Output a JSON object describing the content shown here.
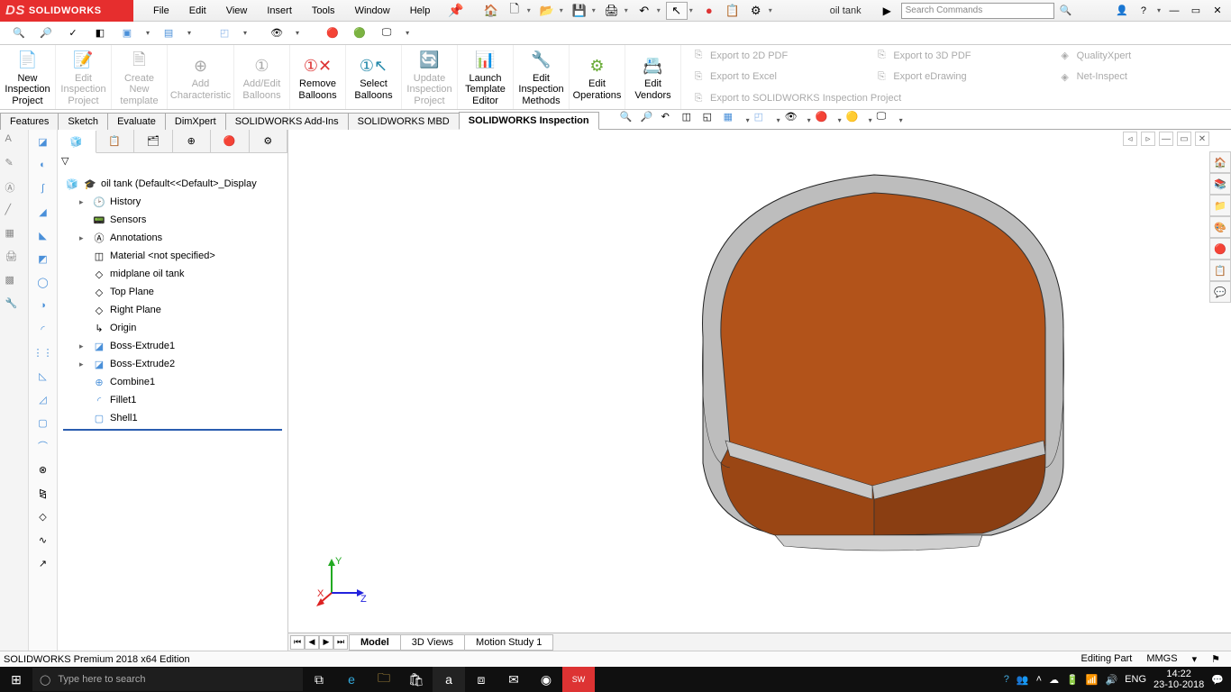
{
  "app_name": "SOLIDWORKS",
  "menus": [
    "File",
    "Edit",
    "View",
    "Insert",
    "Tools",
    "Window",
    "Help"
  ],
  "doc_title": "oil tank",
  "search_placeholder": "Search Commands",
  "ribbon": {
    "new_inspection": "New Inspection Project",
    "edit_inspection": "Edit Inspection Project",
    "create_template": "Create New template",
    "add_char": "Add Characteristic",
    "addedit_balloons": "Add/Edit Balloons",
    "remove_balloons": "Remove Balloons",
    "select_balloons": "Select Balloons",
    "update_project": "Update Inspection Project",
    "launch_te": "Launch Template Editor",
    "edit_methods": "Edit Inspection Methods",
    "edit_ops": "Edit Operations",
    "edit_vendors": "Edit Vendors",
    "export_2dpdf": "Export to 2D PDF",
    "export_excel": "Export to Excel",
    "export_swip": "Export to SOLIDWORKS Inspection Project",
    "export_3dpdf": "Export to 3D PDF",
    "export_edraw": "Export eDrawing",
    "qualityxpert": "QualityXpert",
    "netinspect": "Net-Inspect"
  },
  "tabs": [
    "Features",
    "Sketch",
    "Evaluate",
    "DimXpert",
    "SOLIDWORKS Add-Ins",
    "SOLIDWORKS MBD",
    "SOLIDWORKS Inspection"
  ],
  "active_tab": 6,
  "tree": {
    "root": "oil tank  (Default<<Default>_Display",
    "items": [
      "History",
      "Sensors",
      "Annotations",
      "Material <not specified>",
      "midplane oil tank",
      "Top Plane",
      "Right Plane",
      "Origin",
      "Boss-Extrude1",
      "Boss-Extrude2",
      "Combine1",
      "Fillet1",
      "Shell1"
    ]
  },
  "viewport_tabs": [
    "Model",
    "3D Views",
    "Motion Study 1"
  ],
  "status": {
    "edition": "SOLIDWORKS Premium 2018 x64 Edition",
    "mode": "Editing Part",
    "units": "MMGS"
  },
  "taskbar": {
    "search": "Type here to search",
    "lang": "ENG",
    "time": "14:22",
    "date": "23-10-2018"
  }
}
